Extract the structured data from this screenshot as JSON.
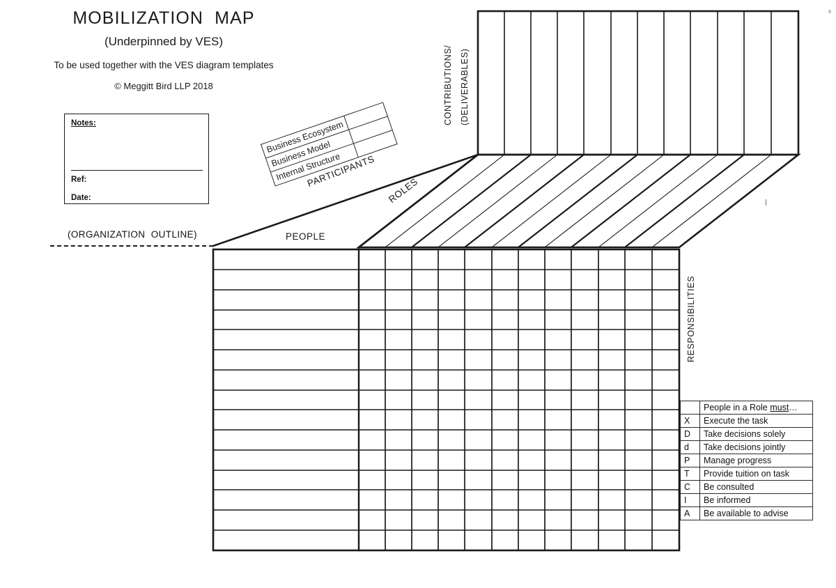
{
  "title": {
    "main": "MOBILIZATION  MAP",
    "subtitle": "(Underpinned by VES)",
    "usage_note": "To be used together with the VES diagram templates",
    "copyright": "© Meggitt Bird LLP 2018"
  },
  "notes_box": {
    "notes_label": "Notes:",
    "ref_label": "Ref:",
    "date_label": "Date:"
  },
  "organization": {
    "outline_label": "(ORGANIZATION  OUTLINE)"
  },
  "axes": {
    "people": "PEOPLE",
    "participants": "PARTICIPANTS",
    "roles": "ROLES",
    "responsibilities": "RESPONSIBILITIES",
    "contributions_line1": "CONTRIBUTIONS/",
    "contributions_line2": "(DELIVERABLES)"
  },
  "source_table": {
    "rows": [
      "Business Ecosystem",
      "Business Model",
      "Internal Structure"
    ]
  },
  "legend": {
    "header": "People in a Role must…",
    "header_underlined_word": "must",
    "rows": [
      {
        "code": "X",
        "description": "Execute the task"
      },
      {
        "code": "D",
        "description": "Take decisions solely"
      },
      {
        "code": "d",
        "description": "Take decisions jointly"
      },
      {
        "code": "P",
        "description": "Manage progress"
      },
      {
        "code": "T",
        "description": "Provide tuition on task"
      },
      {
        "code": "C",
        "description": "Be consulted"
      },
      {
        "code": "I",
        "description": "Be informed"
      },
      {
        "code": "A",
        "description": "Be available to advise"
      }
    ]
  },
  "grids": {
    "main_grid": {
      "rows": 15,
      "name_column_count": 1,
      "value_column_count": 12
    },
    "top_panel": {
      "columns": 12
    },
    "diagonal_band": {
      "lanes": 12
    }
  },
  "colors": {
    "ink": "#1a1a1a",
    "rule": "#2b2b2b",
    "paper": "#ffffff"
  }
}
